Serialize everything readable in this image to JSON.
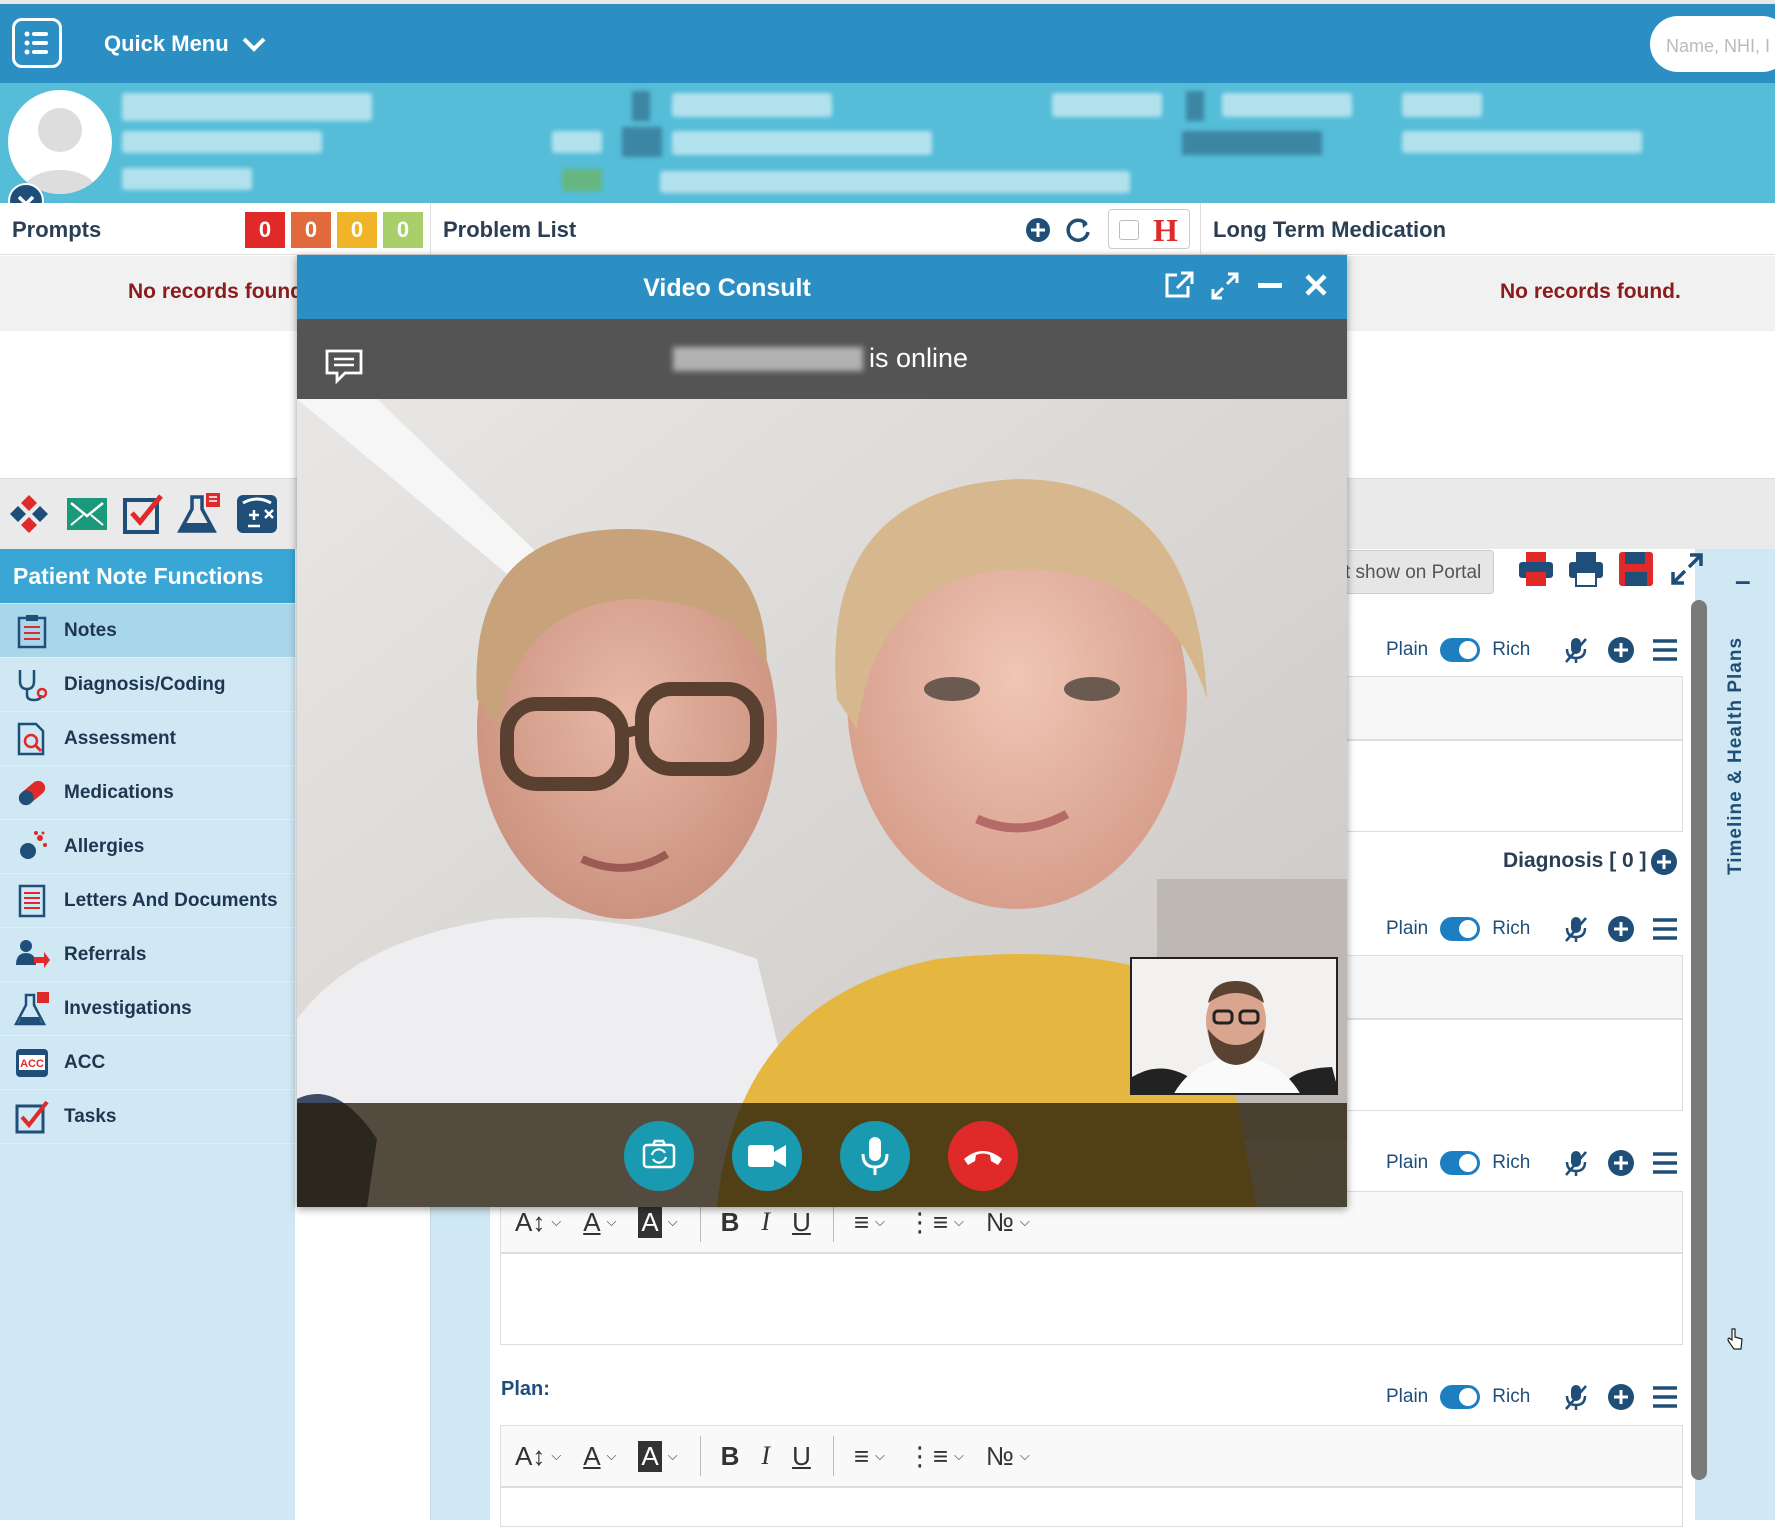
{
  "topbar": {
    "quick_menu_label": "Quick Menu",
    "search_placeholder": "Name, NHI, I"
  },
  "prompts": {
    "title": "Prompts",
    "counts": [
      {
        "value": "0",
        "color": "#e02a2a"
      },
      {
        "value": "0",
        "color": "#e06a3c"
      },
      {
        "value": "0",
        "color": "#f0b429"
      },
      {
        "value": "0",
        "color": "#a9cf6b"
      }
    ],
    "empty_text": "No records found"
  },
  "problem_list": {
    "title": "Problem List",
    "h_label": "H"
  },
  "long_term_medication": {
    "title": "Long Term Medication",
    "empty_text": "No records found."
  },
  "sidebar": {
    "title": "Patient Note Functions",
    "items": [
      {
        "label": "Notes",
        "icon": "clipboard-icon"
      },
      {
        "label": "Diagnosis/Coding",
        "icon": "stethoscope-icon"
      },
      {
        "label": "Assessment",
        "icon": "magnifier-document-icon"
      },
      {
        "label": "Medications",
        "icon": "pill-icon"
      },
      {
        "label": "Allergies",
        "icon": "allergen-icon"
      },
      {
        "label": "Letters And Documents",
        "icon": "document-icon"
      },
      {
        "label": "Referrals",
        "icon": "referral-icon"
      },
      {
        "label": "Investigations",
        "icon": "flask-icon"
      },
      {
        "label": "ACC",
        "icon": "acc-icon"
      },
      {
        "label": "Tasks",
        "icon": "checkbox-icon"
      }
    ]
  },
  "notes": {
    "portal_button": "t show on Portal",
    "plain_label": "Plain",
    "rich_label": "Rich",
    "diagnosis_label": "Diagnosis [ 0 ]",
    "plan_label": "Plan:"
  },
  "right_rail": {
    "label": "Timeline & Health Plans",
    "collapse": "–"
  },
  "video_consult": {
    "title": "Video Consult",
    "status_text": "is online"
  },
  "colors": {
    "brand_blue": "#2b8fc4",
    "banner_blue": "#55bdd8",
    "hangup_red": "#e02a2a",
    "control_teal": "#1a9ab0"
  }
}
